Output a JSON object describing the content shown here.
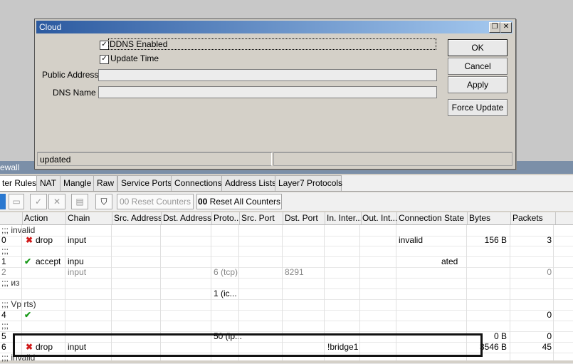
{
  "dialog": {
    "title": "Cloud",
    "ddns_enabled_label": "DDNS Enabled",
    "ddns_enabled_checked": true,
    "update_time_label": "Update Time",
    "update_time_checked": true,
    "public_address_label": "Public Address:",
    "public_address_value": "",
    "dns_name_label": "DNS Name",
    "dns_name_value": "",
    "buttons": {
      "ok": "OK",
      "cancel": "Cancel",
      "apply": "Apply",
      "force_update": "Force Update"
    },
    "status": "updated",
    "restore_glyph": "❐",
    "close_glyph": "✕"
  },
  "firewall": {
    "window_title": "ewall",
    "tabs": [
      "ter Rules",
      "NAT",
      "Mangle",
      "Raw",
      "Service Ports",
      "Connections",
      "Address Lists",
      "Layer7 Protocols"
    ],
    "toolbar": {
      "reset_counters": "Reset Counters",
      "reset_all_counters": "Reset All Counters",
      "counter_glyph": "00"
    },
    "columns": [
      "Action",
      "Chain",
      "Src. Address",
      "Dst. Address",
      "Proto...",
      "Src. Port",
      "Dst. Port",
      "In. Inter...",
      "Out. Int...",
      "Connection State",
      "Bytes",
      "Packets"
    ],
    "rows": [
      {
        "type": "section",
        "text": ";;; invalid"
      },
      {
        "type": "rule",
        "num": "0",
        "action": "drop",
        "action_icon": "x",
        "chain": "input",
        "proto": "",
        "dst_port": "",
        "in_iface": "",
        "conn_state": "invalid",
        "bytes": "156 B",
        "packets": "3"
      },
      {
        "type": "section",
        "text": ";;;"
      },
      {
        "type": "rule",
        "num": "1",
        "action": "accept",
        "action_icon": "check",
        "chain": "inpu",
        "proto": "",
        "dst_port": "",
        "in_iface": "",
        "conn_state": "ated",
        "bytes": "",
        "packets": ""
      },
      {
        "type": "rule",
        "num": "2",
        "action": "",
        "action_icon": "",
        "chain": "input",
        "proto": "6 (tcp)",
        "dst_port": "8291",
        "in_iface": "",
        "conn_state": "",
        "bytes": "",
        "packets": "0"
      },
      {
        "type": "section",
        "text": ";;; из"
      },
      {
        "type": "rule",
        "num": "",
        "action": "",
        "action_icon": "",
        "chain": "",
        "proto": "1 (ic...",
        "dst_port": "",
        "in_iface": "",
        "conn_state": "",
        "bytes": "",
        "packets": ""
      },
      {
        "type": "section",
        "text": ";;; Vp                    rts)"
      },
      {
        "type": "rule",
        "num": "4",
        "action": "",
        "action_icon": "check",
        "chain": "",
        "proto": "",
        "dst_port": "",
        "in_iface": "",
        "conn_state": "",
        "bytes": "",
        "packets": "0"
      },
      {
        "type": "section",
        "text": ";;;"
      },
      {
        "type": "rule",
        "num": "5",
        "action": "",
        "action_icon": "",
        "chain": "",
        "proto": "50 (ip...",
        "dst_port": "",
        "in_iface": "",
        "conn_state": "",
        "bytes": "0 B",
        "packets": "0"
      },
      {
        "type": "rule",
        "num": "6",
        "action": "drop",
        "action_icon": "x",
        "chain": "input",
        "proto": "",
        "dst_port": "",
        "in_iface": "!bridge1",
        "conn_state": "",
        "bytes": "3546 B",
        "packets": "45"
      },
      {
        "type": "section",
        "text": ";;; invalid"
      }
    ]
  }
}
